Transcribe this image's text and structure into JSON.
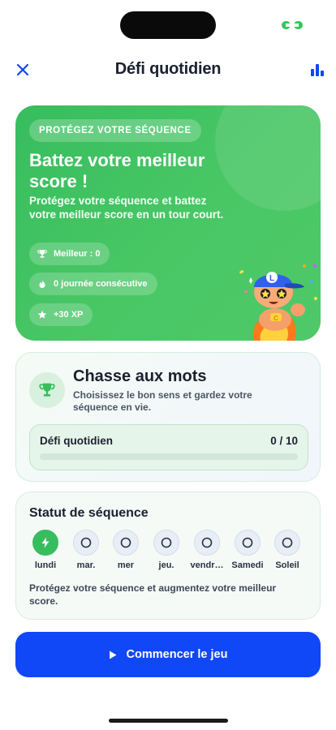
{
  "header": {
    "title": "Défi quotidien",
    "close_icon": "close-icon",
    "stats_icon": "bar-chart-icon"
  },
  "hero": {
    "badge": "PROTÉGEZ VOTRE SÉQUENCE",
    "title": "Battez votre meilleur score !",
    "description": "Protégez votre séquence et battez votre meilleur score en un tour court.",
    "stats": [
      {
        "icon": "trophy-icon",
        "label": "Meilleur : 0"
      },
      {
        "icon": "flame-icon",
        "label": "0 journée consécutive"
      },
      {
        "icon": "star-icon",
        "label": "+30 XP"
      }
    ],
    "mascot_icon": "mascot-character-icon"
  },
  "game": {
    "icon": "trophy-icon",
    "title": "Chasse aux mots",
    "description": "Choisissez le bon sens et gardez votre séquence en vie.",
    "progress": {
      "label": "Défi quotidien",
      "count": "0 / 10",
      "current": 0,
      "total": 10
    }
  },
  "streak": {
    "title": "Statut de séquence",
    "days": [
      {
        "label": "lundi",
        "done": true
      },
      {
        "label": "mar.",
        "done": false
      },
      {
        "label": "mer",
        "done": false
      },
      {
        "label": "jeu.",
        "done": false
      },
      {
        "label": "vendr…",
        "done": false
      },
      {
        "label": "Samedi",
        "done": false
      },
      {
        "label": "Soleil",
        "done": false
      }
    ],
    "description": "Protégez votre séquence et augmentez votre meilleur score."
  },
  "play_button": {
    "label": "Commencer le jeu",
    "icon": "play-icon"
  },
  "colors": {
    "green": "#37bd5e",
    "blue": "#1047f7",
    "text": "#1b2030"
  }
}
